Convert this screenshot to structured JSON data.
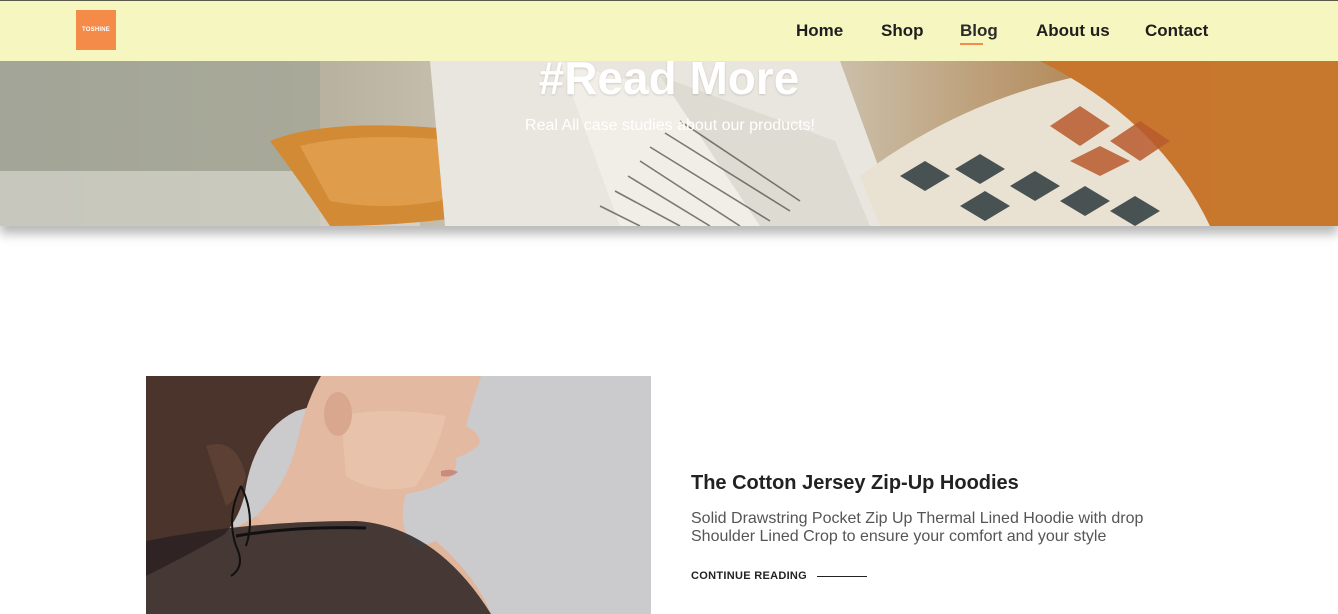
{
  "header": {
    "logo_text": "TOSHINE",
    "nav": [
      {
        "label": "Home"
      },
      {
        "label": "Shop"
      },
      {
        "label": "Blog",
        "active": true
      },
      {
        "label": "About us"
      },
      {
        "label": "Contact"
      }
    ]
  },
  "hero": {
    "title": "#Read More",
    "subtitle": "Real All case studies about our products!"
  },
  "post": {
    "title": "The Cotton Jersey Zip-Up Hoodies",
    "excerpt": "Solid Drawstring Pocket Zip Up Thermal Lined Hoodie with drop Shoulder Lined Crop to ensure your comfort and your style",
    "continue_label": "CONTINUE READING"
  },
  "colors": {
    "header_bg": "#f6f6c1",
    "accent": "#f58b48",
    "text_dark": "#222222",
    "text_muted": "#555555"
  }
}
